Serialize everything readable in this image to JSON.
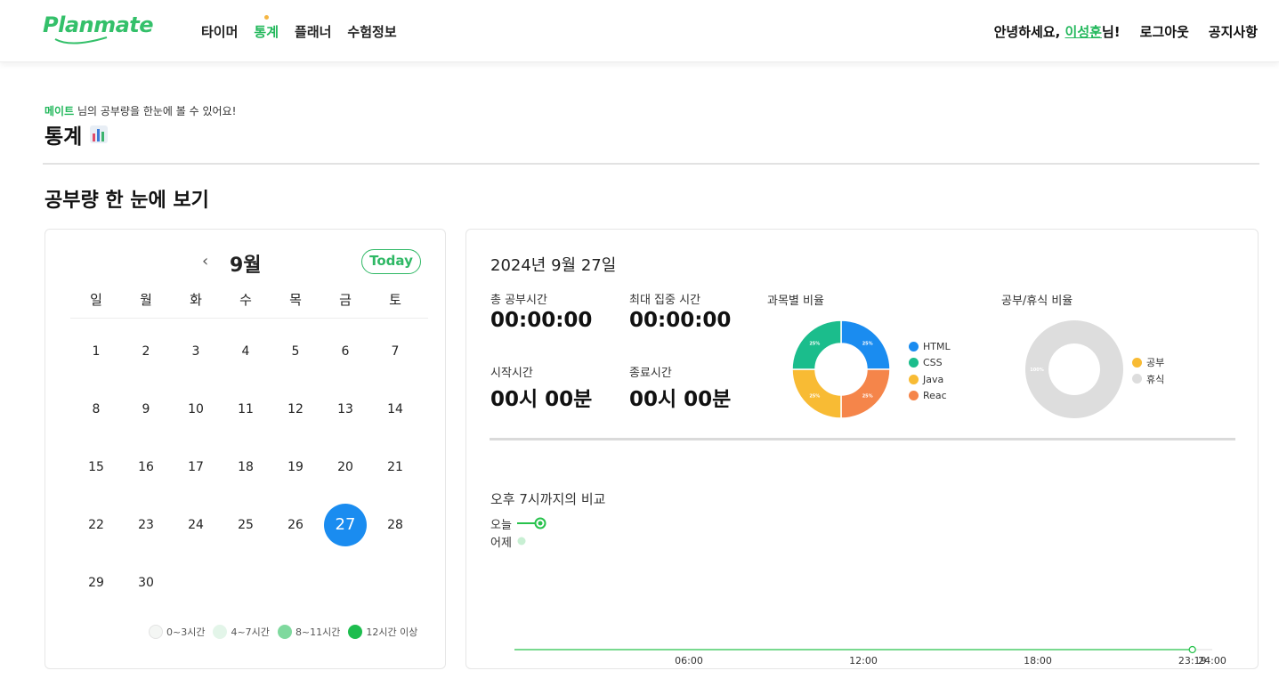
{
  "header": {
    "logo": "Planmate",
    "nav": [
      {
        "label": "타이머",
        "active": false
      },
      {
        "label": "통계",
        "active": true
      },
      {
        "label": "플래너",
        "active": false
      },
      {
        "label": "수험정보",
        "active": false
      }
    ],
    "greeting_prefix": "안녕하세요,",
    "username": "이성훈",
    "greeting_suffix": "님!",
    "logout": "로그아웃",
    "notice": "공지사항"
  },
  "intro": {
    "mate": "메이트",
    "subtitle_rest": "님의 공부량을 한눈에 볼 수 있어요!",
    "title": "통계"
  },
  "section_title": "공부량 한 눈에 보기",
  "calendar": {
    "prev_icon": "‹",
    "month": "9월",
    "today_button": "Today",
    "weekdays": [
      "일",
      "월",
      "화",
      "수",
      "목",
      "금",
      "토"
    ],
    "days": [
      "1",
      "2",
      "3",
      "4",
      "5",
      "6",
      "7",
      "8",
      "9",
      "10",
      "11",
      "12",
      "13",
      "14",
      "15",
      "16",
      "17",
      "18",
      "19",
      "20",
      "21",
      "22",
      "23",
      "24",
      "25",
      "26",
      "27",
      "28",
      "29",
      "30"
    ],
    "first_weekday_index": 0,
    "selected_day": "27",
    "legend": [
      {
        "label": "0~3시간",
        "color": "#f4f6f4"
      },
      {
        "label": "4~7시간",
        "color": "#e3f5e9"
      },
      {
        "label": "8~11시간",
        "color": "#7fd99e"
      },
      {
        "label": "12시간 이상",
        "color": "#1dbd4e"
      }
    ]
  },
  "stats": {
    "date": "2024년 9월 27일",
    "total_study_label": "총 공부시간",
    "total_study_value": "00:00:00",
    "max_focus_label": "최대 집중 시간",
    "max_focus_value": "00:00:00",
    "start_label": "시작시간",
    "start_value": "00시 00분",
    "end_label": "종료시간",
    "end_value": "00시 00분",
    "subject_chart": {
      "title": "과목별 비율",
      "type": "pie",
      "slices": [
        {
          "label": "HTML",
          "value": 25,
          "color": "#1a8cf0",
          "text": "25%"
        },
        {
          "label": "Reac",
          "value": 25,
          "color": "#f5854a",
          "text": "25%"
        },
        {
          "label": "Java",
          "value": 25,
          "color": "#f8bb34",
          "text": "25%"
        },
        {
          "label": "CSS",
          "value": 25,
          "color": "#1bbd8c",
          "text": "25%"
        }
      ],
      "legend_order": [
        "HTML",
        "CSS",
        "Java",
        "Reac"
      ]
    },
    "rest_chart": {
      "title": "공부/휴식 비율",
      "type": "pie",
      "slices": [
        {
          "label": "휴식",
          "value": 100,
          "color": "#dddddd",
          "text": "100%"
        }
      ],
      "legend": [
        {
          "label": "공부",
          "color": "#f8bb34"
        },
        {
          "label": "휴식",
          "color": "#dddddd"
        }
      ]
    },
    "compare_title": "오후 7시까지의 비교",
    "series_legend": [
      {
        "label": "오늘",
        "color": "#27c24c"
      },
      {
        "label": "어제",
        "color": "#c8efd3"
      }
    ]
  },
  "chart_data": {
    "type": "line",
    "x_ticks": [
      "06:00",
      "12:00",
      "18:00",
      "23:19",
      "24:00"
    ],
    "series": [
      {
        "name": "오늘",
        "x": [
          "00:00",
          "23:19"
        ],
        "y": [
          0,
          0
        ]
      }
    ],
    "ylim": [
      0,
      1
    ]
  }
}
